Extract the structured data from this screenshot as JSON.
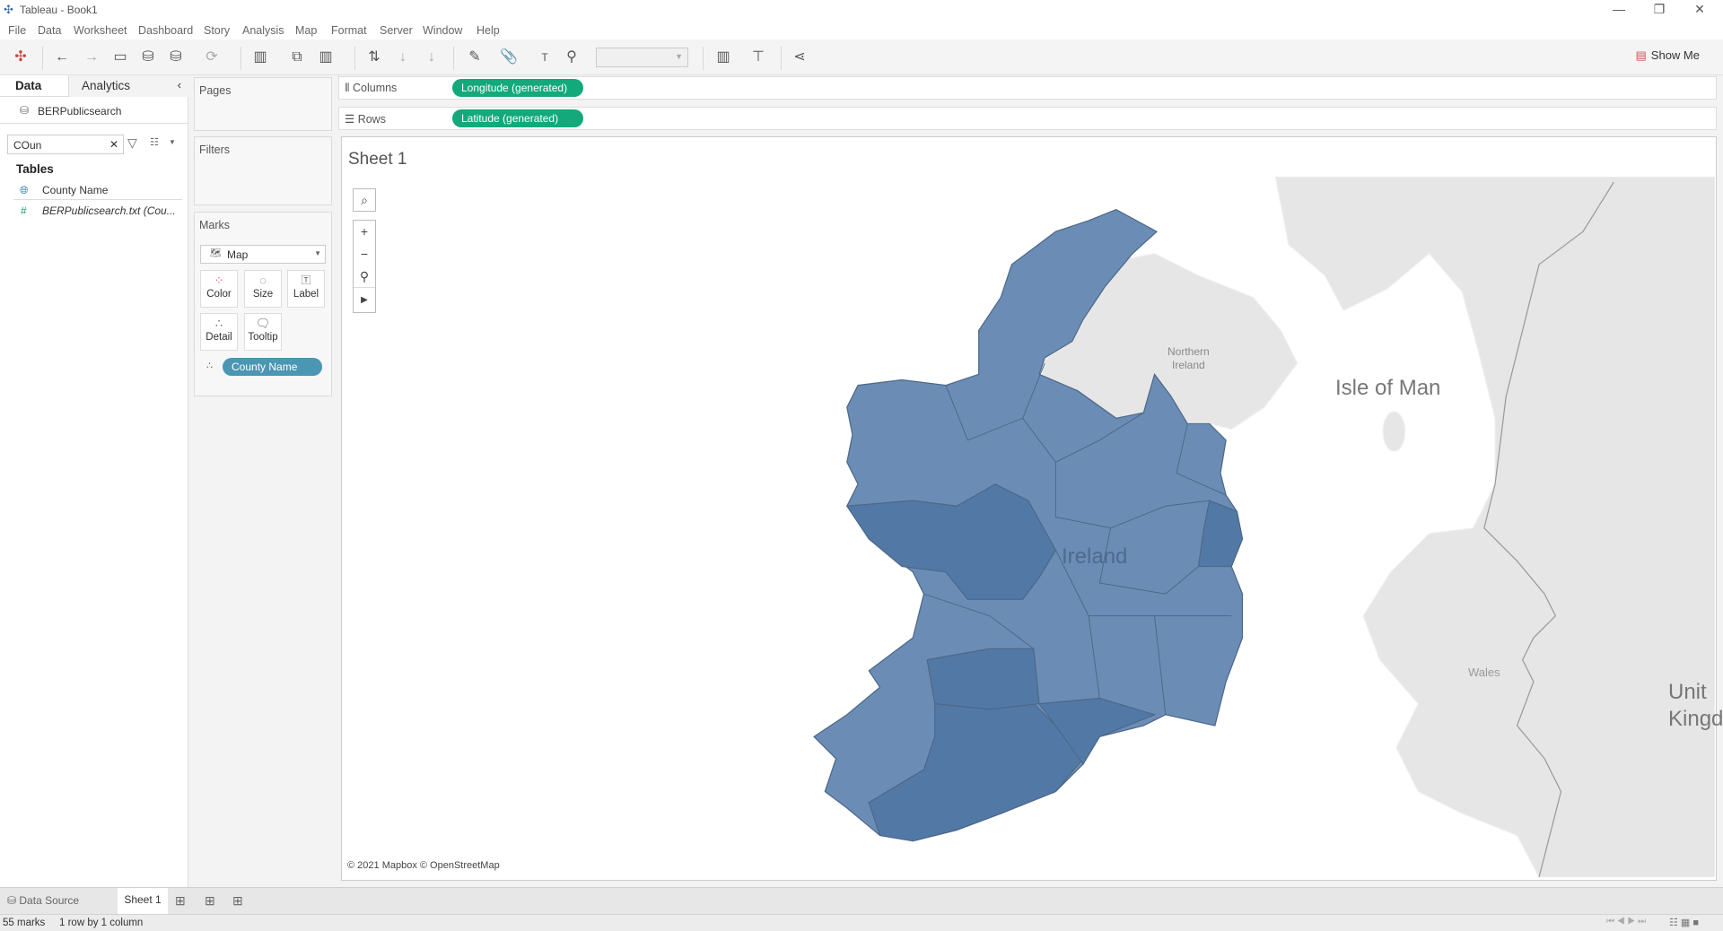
{
  "window": {
    "title": "Tableau - Book1"
  },
  "menu": [
    "File",
    "Data",
    "Worksheet",
    "Dashboard",
    "Story",
    "Analysis",
    "Map",
    "Format",
    "Server",
    "Window",
    "Help"
  ],
  "toolbar": {
    "show_me": "Show Me"
  },
  "left_panel": {
    "tabs": [
      "Data",
      "Analytics"
    ],
    "datasource": "BERPublicsearch",
    "search_value": "COun",
    "tables_heading": "Tables",
    "fields": [
      {
        "name": "County Name",
        "icon": "globe-icon"
      },
      {
        "name": "BERPublicsearch.txt (Cou...",
        "icon": "number-icon"
      }
    ]
  },
  "shelves": {
    "pages": "Pages",
    "filters": "Filters",
    "marks": "Marks",
    "mark_type": "Map",
    "cards": [
      "Color",
      "Size",
      "Label",
      "Detail",
      "Tooltip"
    ],
    "detail_pill": "County Name",
    "columns_label": "Columns",
    "columns_pill": "Longitude (generated)",
    "rows_label": "Rows",
    "rows_pill": "Latitude (generated)"
  },
  "sheet": {
    "title": "Sheet 1",
    "map_labels": {
      "northern_ireland_1": "Northern",
      "northern_ireland_2": "Ireland",
      "isle_of_man": "Isle of Man",
      "ireland": "Ireland",
      "wales": "Wales",
      "uk_1": "Unit",
      "uk_2": "Kingd"
    },
    "attribution": "© 2021 Mapbox © OpenStreetMap",
    "colors": {
      "county_light": "#6b8db5",
      "county_dark": "#5279a6",
      "land": "#e6e6e6",
      "water": "#ffffff"
    }
  },
  "bottom_tabs": {
    "data_source": "Data Source",
    "sheet": "Sheet 1"
  },
  "status": {
    "marks": "55 marks",
    "dims": "1 row by 1 column"
  }
}
